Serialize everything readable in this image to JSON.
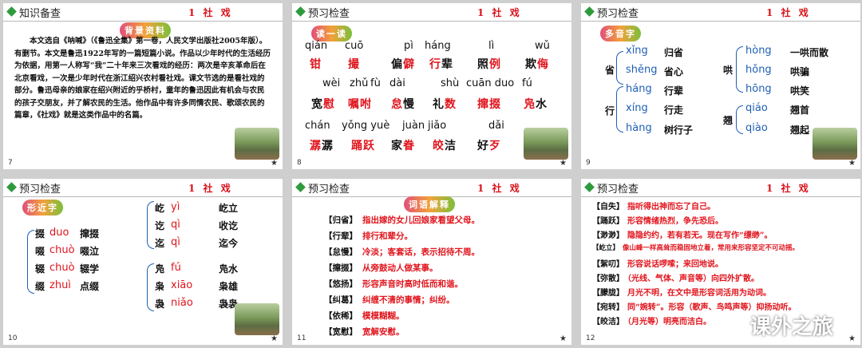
{
  "slides": [
    {
      "header": "知识备查",
      "title": "1 社 戏",
      "number": "7",
      "badge": "背景资料",
      "body": "本文选自《呐喊》（《鲁迅全集》第一卷，人民文学出版社2005年版）。有删节。本文是鲁迅1922年写的一篇短篇小说。作品以少年时代的生活经历为依据，用第一人称写“我”二十年来三次看戏的经历：两次是辛亥革命后在北京看戏，一次是少年时代在浙江绍兴农村看社戏。课文节选的是看社戏的部分。鲁迅母亲的娘家在绍兴附近的乎桥村，童年的鲁迅因此有机会与农民的孩子交朋友，并了解农民的生活。他作品中有许多同情农民、歌颂农民的篇章，《社戏》就是这类作品中的名篇。"
    },
    {
      "header": "预习检查",
      "title": "1 社 戏",
      "number": "8",
      "badge": "读一读",
      "row1_py": [
        "qián",
        "cuō",
        "pì",
        "háng",
        "lì",
        "wǔ"
      ],
      "row1": [
        "钳",
        "撮",
        "偏",
        "僻",
        "行",
        "辈",
        "照",
        "例",
        "欺",
        "侮"
      ],
      "row2_py": [
        "wèi",
        "zhǔ",
        "fù",
        "dài",
        "shù",
        "cuān duo",
        "fú"
      ],
      "row2": [
        "宽",
        "慰",
        "嘱",
        "咐",
        "怠",
        "慢",
        "礼",
        "数",
        "撺",
        "掇",
        "凫",
        "水"
      ],
      "row3_py": [
        "chán",
        "yǒng yuè",
        "juàn",
        "jiǎo",
        "dǎi"
      ],
      "row3": [
        "潺",
        "潺",
        "踊",
        "跃",
        "家",
        "眷",
        "皎",
        "洁",
        "好",
        "歹"
      ]
    },
    {
      "header": "预习检查",
      "title": "1 社 戏",
      "number": "9",
      "badge": "多音字",
      "g1": "省",
      "g1_items": [
        [
          "xǐng",
          "归省"
        ],
        [
          "shěng",
          "省心"
        ]
      ],
      "g2": "行",
      "g2_items": [
        [
          "háng",
          "行辈"
        ],
        [
          "xíng",
          "行走"
        ],
        [
          "hàng",
          "树行子"
        ]
      ],
      "g3": "哄",
      "g3_items": [
        [
          "hòng",
          "一哄而散"
        ],
        [
          "hǒng",
          "哄骗"
        ],
        [
          "hōng",
          "哄笑"
        ]
      ],
      "g4": "翘",
      "g4_items": [
        [
          "qiáo",
          "翘首"
        ],
        [
          "qiào",
          "翘起"
        ]
      ]
    },
    {
      "header": "预习检查",
      "title": "1 社 戏",
      "number": "10",
      "badge": "形近字",
      "a": [
        [
          "掇",
          "duo",
          "撺掇"
        ],
        [
          "啜",
          "chuò",
          "啜泣"
        ],
        [
          "辍",
          "chuò",
          "辍学"
        ],
        [
          "缀",
          "zhuì",
          "点缀"
        ]
      ],
      "b": [
        [
          "屹",
          "yì",
          "屹立"
        ],
        [
          "讫",
          "qì",
          "收讫"
        ],
        [
          "迄",
          "qì",
          "迄今"
        ]
      ],
      "c": [
        [
          "凫",
          "fú",
          "凫水"
        ],
        [
          "枭",
          "xiāo",
          "枭雄"
        ],
        [
          "袅",
          "niǎo",
          "袅袅"
        ]
      ]
    },
    {
      "header": "预习检查",
      "title": "1 社 戏",
      "number": "11",
      "badge": "词语解释",
      "items": [
        [
          "【归省】",
          "指出嫁的女儿回娘家看望父母。"
        ],
        [
          "【行辈】",
          "排行和辈分。"
        ],
        [
          "【怠慢】",
          "冷淡；客套话，表示招待不周。"
        ],
        [
          "【撺掇】",
          "从旁鼓动人做某事。"
        ],
        [
          "【悠扬】",
          "形容声音时高时低而和谐。"
        ],
        [
          "【纠葛】",
          "纠缠不清的事情；纠纷。"
        ],
        [
          "【依稀】",
          "模模糊糊。"
        ],
        [
          "【宽慰】",
          "宽解安慰。"
        ]
      ]
    },
    {
      "header": "预习检查",
      "title": "1 社 戏",
      "number": "12",
      "items": [
        [
          "【自失】",
          "指听得出神而忘了自己。"
        ],
        [
          "【踊跃】",
          "形容情绪热烈，争先恐后。"
        ],
        [
          "【渺渺】",
          "隐隐约约，若有若无。现在写作“缥缈”。"
        ],
        [
          "【屹立】",
          "像山峰一样高耸而稳固地立着，常用来形容坚定不可动摇。"
        ],
        [
          "【絮叨】",
          "形容说话啰嗦；来回地说。"
        ],
        [
          "【弥散】",
          "（光线、气体、声音等）向四外扩散。"
        ],
        [
          "【朦胧】",
          "月光不明，在文中是形容词活用为动词。"
        ],
        [
          "【宛转】",
          "同“婉转”。形容（歌声、鸟鸣声等）抑扬动听。"
        ],
        [
          "【皎洁】",
          "（月光等）明亮而洁白。"
        ]
      ]
    }
  ],
  "watermark": "课外之旅"
}
